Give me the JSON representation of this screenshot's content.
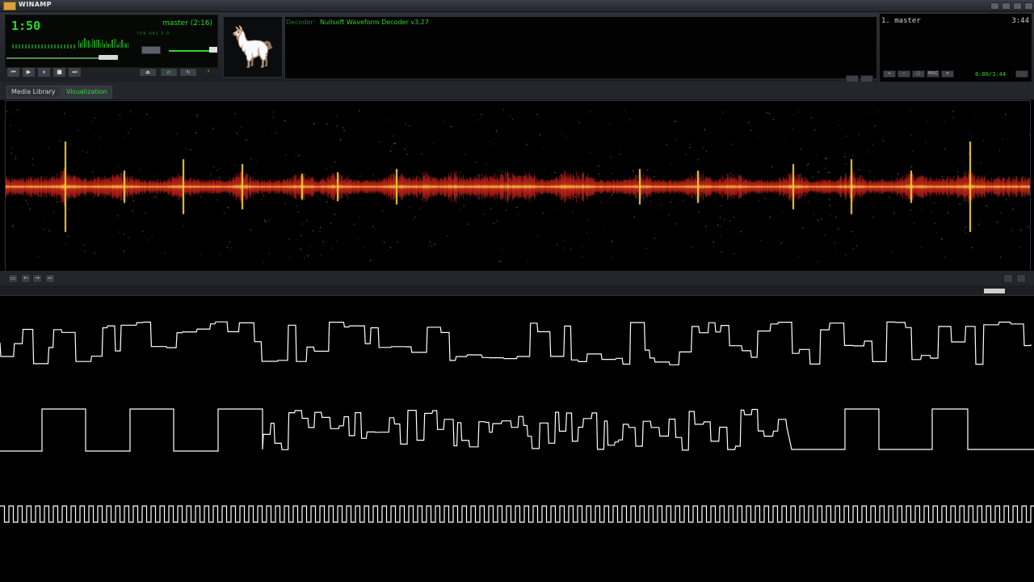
{
  "window": {
    "title": "WINAMP"
  },
  "player": {
    "time": "1:50",
    "track": "master (2:16)",
    "mini_readout": "706 441 0 0"
  },
  "controls": {
    "prev": "⏮",
    "play": "▶",
    "pause": "⏸",
    "stop": "■",
    "next": "⏭",
    "eject": "⏏",
    "shuffle": "⇄",
    "repeat": "↻"
  },
  "info": {
    "decoder_label": "Decoder:",
    "decoder_value": "Nullsoft Waveform Decoder v3.27"
  },
  "playlist": {
    "items": [
      {
        "label": "1. master",
        "duration": "3:44"
      }
    ],
    "position": "0:00/3:44",
    "buttons": [
      "+",
      "−",
      "□",
      "MISC",
      "≡"
    ]
  },
  "tabs": [
    {
      "label": "Media Library",
      "active": false
    },
    {
      "label": "Visualization",
      "active": true
    }
  ],
  "viz_toolbar": {
    "buttons": [
      "▭",
      "←",
      "→",
      "⇨"
    ]
  },
  "colors": {
    "accent_green": "#2bd82b",
    "spectrum_red": "#c0261b",
    "spectrum_yellow": "#f3d13a",
    "scope_line": "#ffffff"
  }
}
